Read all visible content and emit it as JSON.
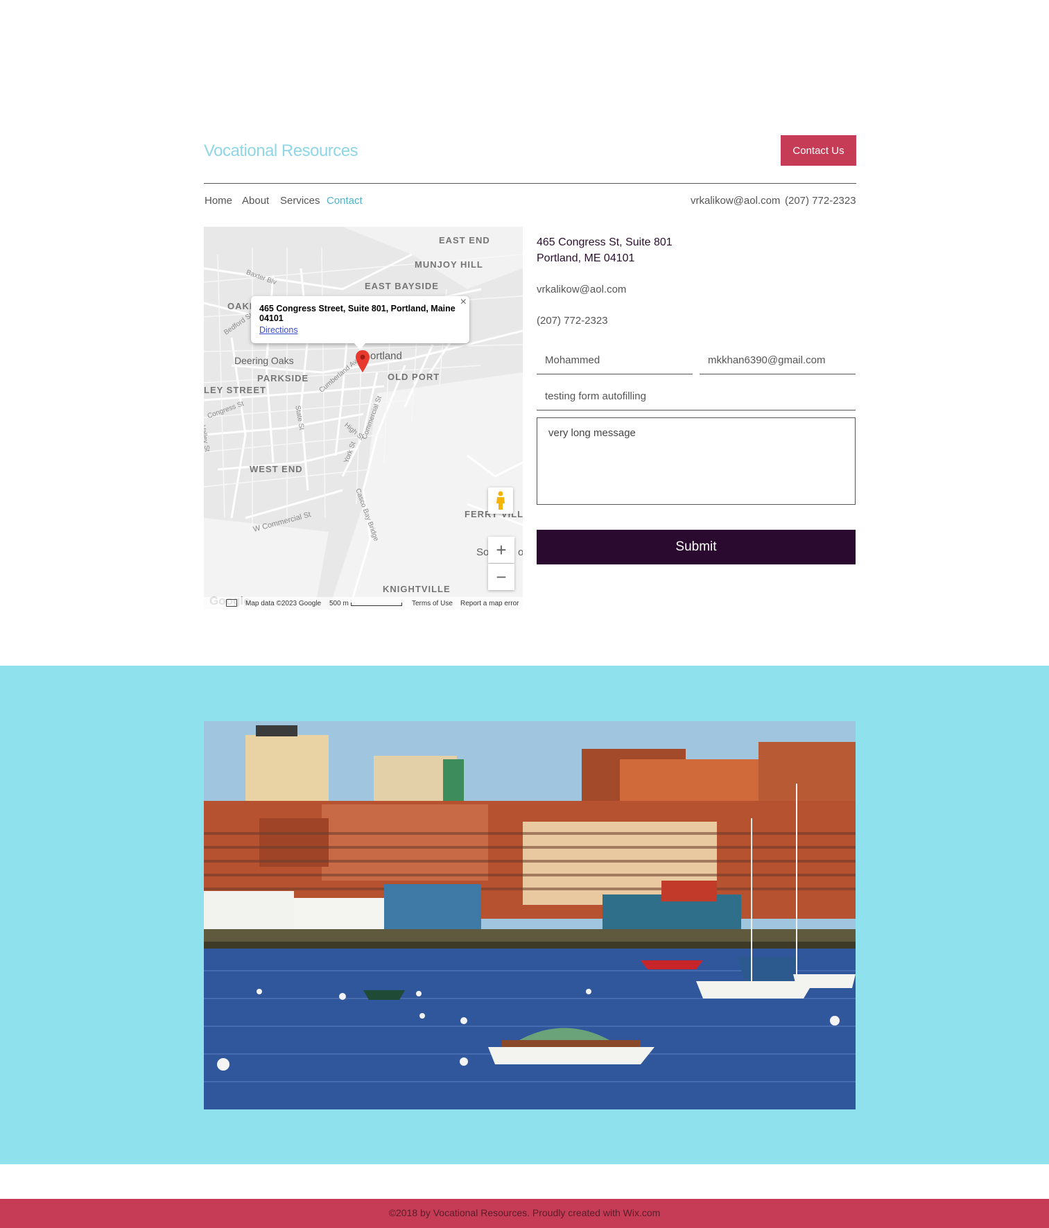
{
  "header": {
    "site_title": "Vocational Resources",
    "contact_button": "Contact Us",
    "email": "vrkalikow@aol.com",
    "phone": "(207) 772-2323"
  },
  "nav": {
    "items": [
      {
        "label": "Home"
      },
      {
        "label": "About"
      },
      {
        "label": "Services"
      },
      {
        "label": "Contact",
        "active": true
      }
    ]
  },
  "map": {
    "info_window": {
      "address": "465 Congress Street, Suite 801, Portland, Maine 04101",
      "directions": "Directions",
      "close": "×"
    },
    "labels": {
      "east_end": "EAST END",
      "munjoy_hill": "MUNJOY HILL",
      "east_bayside": "EAST BAYSIDE",
      "oakdale": "OAKI",
      "deering_oaks": "Deering Oaks",
      "portland": "ortland",
      "parkside": "PARKSIDE",
      "old_port": "OLD PORT",
      "valley_street": "LEY STREET",
      "west_end": "WEST END",
      "ferry_village": "FERRY VILLA",
      "south_portland": "So          o",
      "knightville": "KNIGHTVILLE",
      "baxter": "Baxter Blv",
      "bedford": "Bedford St",
      "cumberland": "Cumberland Av",
      "congress": "Congress St",
      "state": "State St",
      "high": "High St",
      "york": "York St",
      "commercial": "Commercial St",
      "w_commercial": "W Commercial St",
      "casco_bay": "Casco Bay Bridge",
      "valley": "Valley St"
    },
    "zoom_in": "+",
    "zoom_out": "−",
    "footer": {
      "logo": "Google",
      "map_data": "Map data ©2023 Google",
      "scale": "500 m",
      "terms": "Terms of Use",
      "report": "Report a map error"
    }
  },
  "contact_info": {
    "address_line1": "465 Congress St, Suite 801",
    "address_line2": "Portland, ME 04101",
    "email": "vrkalikow@aol.com",
    "phone": "(207) 772-2323"
  },
  "form": {
    "name_value": "Mohammed",
    "email_value": "mkkhan6390@gmail.com",
    "subject_value": "testing form autofilling",
    "message_value": "very long message",
    "submit_label": "Submit"
  },
  "footer": {
    "text": "©2018 by Vocational Resources. Proudly created with Wix.com"
  },
  "colors": {
    "accent_red": "#c63b55",
    "submit_dark": "#2a0a2e",
    "band_cyan": "#8fe1ee",
    "title_cyan": "#8fd6e6"
  }
}
